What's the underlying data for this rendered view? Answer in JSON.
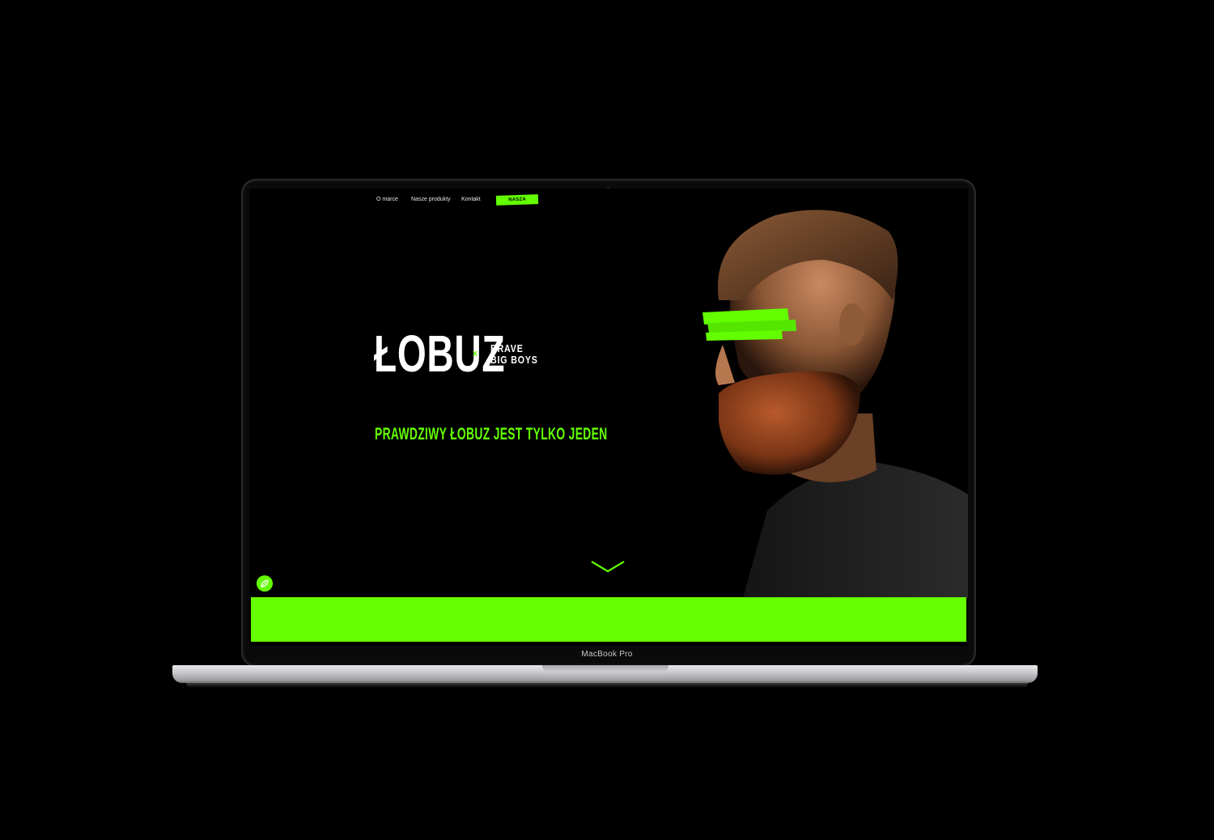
{
  "device": {
    "label": "MacBook Pro"
  },
  "nav": {
    "items": [
      {
        "label": "O marce"
      },
      {
        "label": "Nasze produkty"
      },
      {
        "label": "Kontakt"
      }
    ],
    "cta": "NASZA KOLEKCJA"
  },
  "hero": {
    "logo": "ŁOBUZ",
    "separator": "x",
    "partner_line1": "BRAVE",
    "partner_line2": "BIG BOYS",
    "tagline": "PRAWDZIWY ŁOBUZ JEST TYLKO JEDEN"
  },
  "icons": {
    "scroll": "chevron-down-icon",
    "floating": "chat-icon"
  },
  "colors": {
    "accent": "#63ff00",
    "background": "#000000",
    "text": "#ffffff"
  }
}
